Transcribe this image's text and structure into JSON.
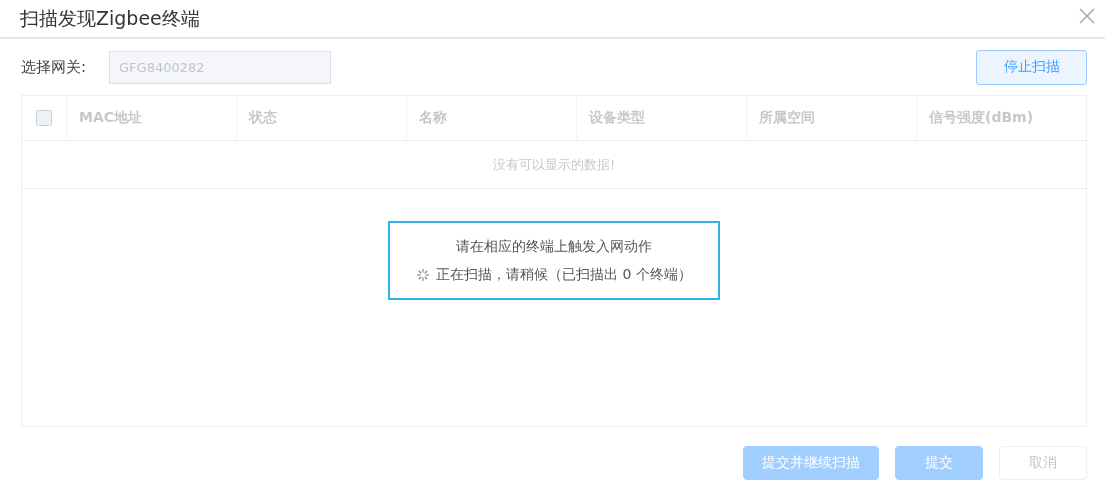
{
  "dialog": {
    "title": "扫描发现Zigbee终端"
  },
  "gateway": {
    "label": "选择网关:",
    "value": "GFG8400282",
    "disabled": true
  },
  "stop_button": {
    "label": "停止扫描"
  },
  "table": {
    "select_all": {
      "checked": false,
      "disabled": true
    },
    "columns": [
      "MAC地址",
      "状态",
      "名称",
      "设备类型",
      "所属空间",
      "信号强度(dBm)"
    ],
    "empty_text": "没有可以显示的数据!"
  },
  "scan_notice": {
    "instruction": "请在相应的终端上触发入网动作",
    "status": "正在扫描，请稍候（已扫描出 0 个终端）"
  },
  "buttons": [
    {
      "label": "提交并继续扫描",
      "kind": "primary",
      "disabled": true
    },
    {
      "label": "提交",
      "kind": "primary",
      "disabled": true
    },
    {
      "label": "取消",
      "kind": "default",
      "disabled": true
    }
  ]
}
